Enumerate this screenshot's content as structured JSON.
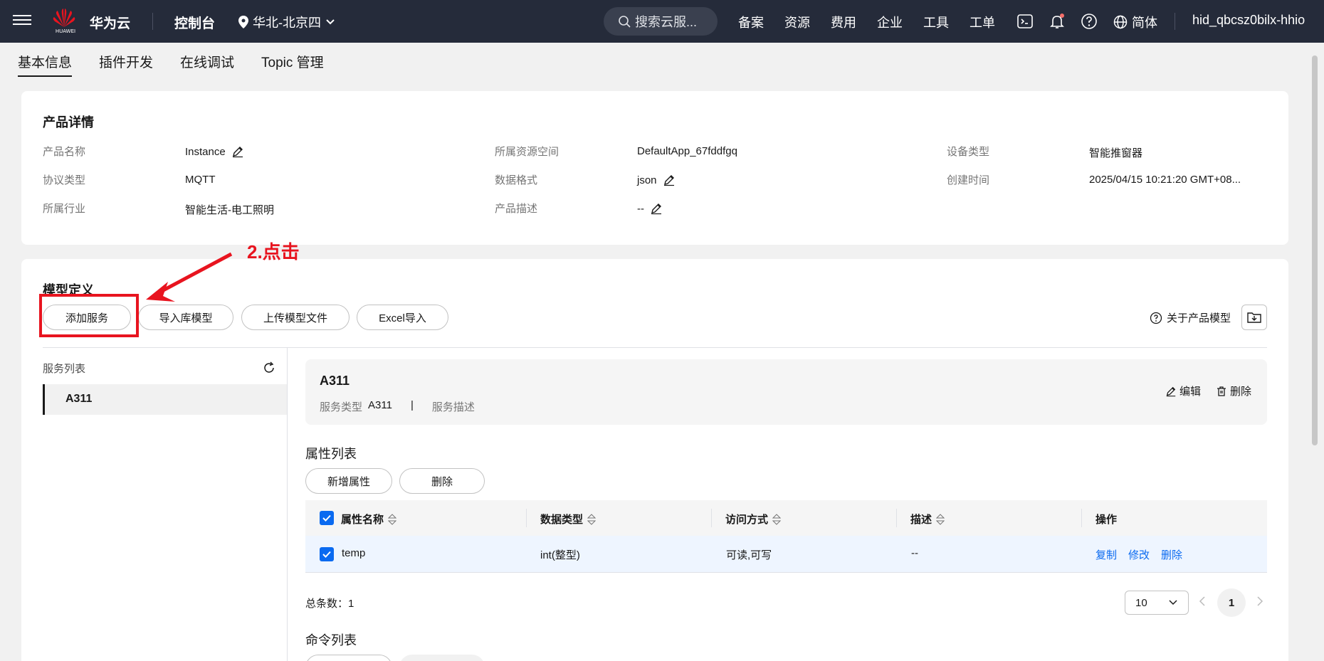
{
  "topbar": {
    "logo_sub": "HUAWEI",
    "brand": "华为云",
    "console": "控制台",
    "region": "华北-北京四",
    "search_placeholder": "搜索云服...",
    "nav": [
      "备案",
      "资源",
      "费用",
      "企业",
      "工具",
      "工单"
    ],
    "lang": "简体",
    "user": "hid_qbcsz0bilx-hhio"
  },
  "tabs": [
    "基本信息",
    "插件开发",
    "在线调试",
    "Topic 管理"
  ],
  "product": {
    "heading": "产品详情",
    "name_label": "产品名称",
    "name": "Instance",
    "space_label": "所属资源空间",
    "space": "DefaultApp_67fddfgq",
    "device_type_label": "设备类型",
    "device_type": "智能推窗器",
    "protocol_label": "协议类型",
    "protocol": "MQTT",
    "format_label": "数据格式",
    "format": "json",
    "created_label": "创建时间",
    "created": "2025/04/15 10:21:20 GMT+08...",
    "industry_label": "所属行业",
    "industry": "智能生活-电工照明",
    "desc_label": "产品描述",
    "desc": "--"
  },
  "model": {
    "heading": "模型定义",
    "buttons": [
      "添加服务",
      "导入库模型",
      "上传模型文件",
      "Excel导入"
    ],
    "about": "关于产品模型",
    "annotation": "2.点击",
    "service_list_label": "服务列表",
    "service_item": "A311"
  },
  "service": {
    "title": "A311",
    "type_label": "服务类型",
    "type": "A311",
    "sep": "|",
    "desc_label": "服务描述",
    "edit": "编辑",
    "delete": "删除"
  },
  "attrs": {
    "heading": "属性列表",
    "add": "新增属性",
    "delete": "删除",
    "columns": [
      "属性名称",
      "数据类型",
      "访问方式",
      "描述",
      "操作"
    ],
    "row": {
      "name": "temp",
      "type": "int(整型)",
      "access": "可读,可写",
      "desc": "--"
    },
    "ops": [
      "复制",
      "修改",
      "删除"
    ],
    "total": "总条数：1",
    "page_size": "10",
    "page": "1"
  },
  "commands": {
    "heading": "命令列表"
  }
}
